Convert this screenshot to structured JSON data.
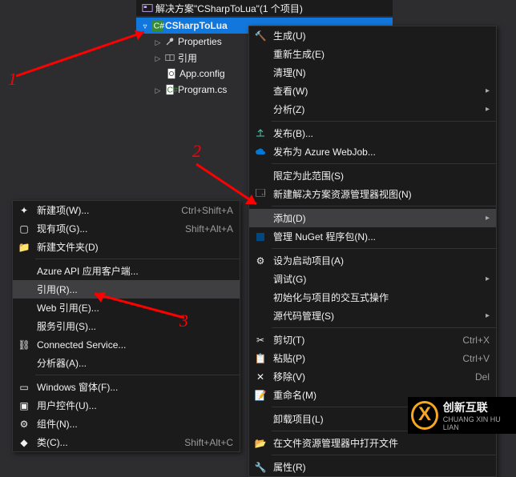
{
  "solution": {
    "title": "解决方案\"CSharpToLua\"(1 个项目)",
    "project": "CSharpToLua",
    "nodes": {
      "properties": "Properties",
      "references": "引用",
      "appconfig": "App.config",
      "programcs": "Program.cs"
    }
  },
  "menu1": {
    "build": "生成(U)",
    "rebuild": "重新生成(E)",
    "clean": "清理(N)",
    "view": "查看(W)",
    "analyze": "分析(Z)",
    "publish": "发布(B)...",
    "azure": "发布为 Azure WebJob...",
    "scope": "限定为此范围(S)",
    "newview": "新建解决方案资源管理器视图(N)",
    "add": "添加(D)",
    "nuget": "管理 NuGet 程序包(N)...",
    "startup": "设为启动项目(A)",
    "debug": "调试(G)",
    "interactive": "初始化与项目的交互式操作",
    "source": "源代码管理(S)",
    "cut": "剪切(T)",
    "cut_sc": "Ctrl+X",
    "paste": "粘贴(P)",
    "paste_sc": "Ctrl+V",
    "remove": "移除(V)",
    "remove_sc": "Del",
    "rename": "重命名(M)",
    "unload": "卸载项目(L)",
    "explorer": "在文件资源管理器中打开文件",
    "properties": "属性(R)"
  },
  "menu2": {
    "newitem": "新建项(W)...",
    "newitem_sc": "Ctrl+Shift+A",
    "existing": "现有项(G)...",
    "existing_sc": "Shift+Alt+A",
    "newfolder": "新建文件夹(D)",
    "azureapi": "Azure API 应用客户端...",
    "reference": "引用(R)...",
    "webref": "Web 引用(E)...",
    "serviceref": "服务引用(S)...",
    "connected": "Connected Service...",
    "analyzer": "分析器(A)...",
    "winforms": "Windows 窗体(F)...",
    "usercontrol": "用户控件(U)...",
    "component": "组件(N)...",
    "class": "类(C)...",
    "class_sc": "Shift+Alt+C"
  },
  "annotations": {
    "n1": "1",
    "n2": "2",
    "n3": "3"
  },
  "logo": {
    "t1": "创新互联",
    "t2": "CHUANG XIN HU LIAN"
  }
}
